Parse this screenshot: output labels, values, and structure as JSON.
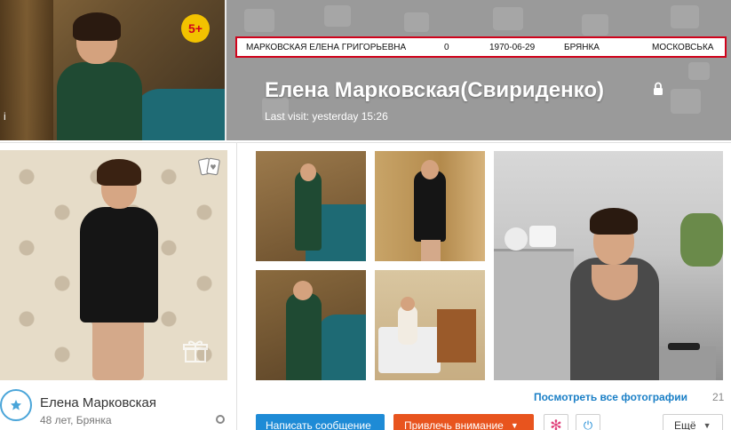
{
  "header": {
    "badge": "5+",
    "info_mark": "i",
    "namebar": {
      "full_name": "МАРКОВСКАЯ ЕЛЕНА ГРИГОРЬЕВНА",
      "zero": "0",
      "birth_date": "1970-06-29",
      "city": "БРЯНКА",
      "region": "МОСКОВСЬКА"
    },
    "profile_name": "Елена Марковская(Свириденко)",
    "last_visit": "Last visit: yesterday 15:26",
    "lock_icon": "lock-icon"
  },
  "user_card": {
    "name": "Елена Марковская",
    "meta": "48 лет, Брянка"
  },
  "photos": {
    "view_all_label": "Посмотреть все фотографии",
    "count": "21"
  },
  "actions": {
    "message_label": "Написать сообщение",
    "attention_label": "Привлечь внимание",
    "snowflake": "✻",
    "power": "⏻",
    "more_label": "Ещё",
    "chevron": "▼"
  },
  "colors": {
    "accent_blue": "#1e8bd6",
    "attention_orange": "#e8541e",
    "badge_yellow": "#f2c200",
    "highlight_red": "#d0021b",
    "link_blue": "#1a7fc6"
  }
}
